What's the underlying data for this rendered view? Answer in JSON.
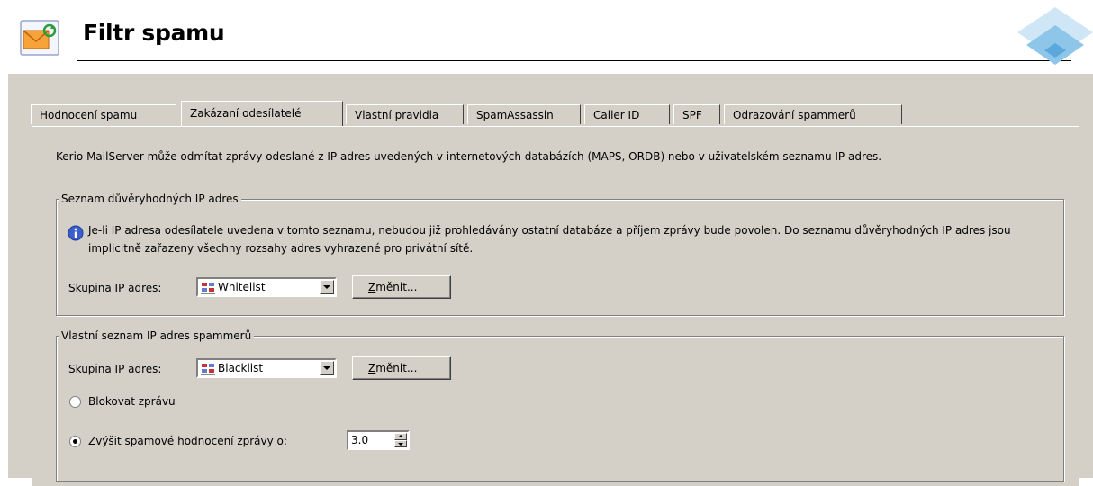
{
  "header": {
    "title": "Filtr spamu"
  },
  "tabs": [
    {
      "label": "Hodnocení spamu"
    },
    {
      "label": "Zakázaní odesílatelé"
    },
    {
      "label": "Vlastní pravidla"
    },
    {
      "label": "SpamAssassin"
    },
    {
      "label": "Caller ID"
    },
    {
      "label": "SPF"
    },
    {
      "label": "Odrazování spammerů"
    }
  ],
  "active_tab": "Zakázaní odesílatelé",
  "description": "Kerio MailServer může odmítat zprávy odeslané z IP adres uvedených v internetových databázích (MAPS, ORDB) nebo v uživatelském seznamu IP adres.",
  "trusted": {
    "legend": "Seznam důvěryhodných IP adres",
    "info": "Je-li IP adresa odesílatele uvedena v tomto seznamu, nebudou již prohledávány ostatní databáze a příjem zprávy bude povolen. Do seznamu důvěryhodných IP adres jsou implicitně zařazeny všechny rozsahy adres vyhrazené pro privátní sítě.",
    "group_label": "Skupina IP adres:",
    "group_value": "Whitelist",
    "change_button_first": "Z",
    "change_button_rest": "měnit..."
  },
  "spammers": {
    "legend": "Vlastní seznam IP adres spammerů",
    "group_label": "Skupina IP adres:",
    "group_value": "Blacklist",
    "change_button_first": "Z",
    "change_button_rest": "měnit...",
    "option_block": "Blokovat zprávu",
    "option_raise": "Zvýšit spamové hodnocení zprávy o:",
    "selected_option": "raise",
    "raise_value": "3.0"
  },
  "colors": {
    "panel": "#d4d0c8",
    "info_icon": "#3a5fcd"
  }
}
